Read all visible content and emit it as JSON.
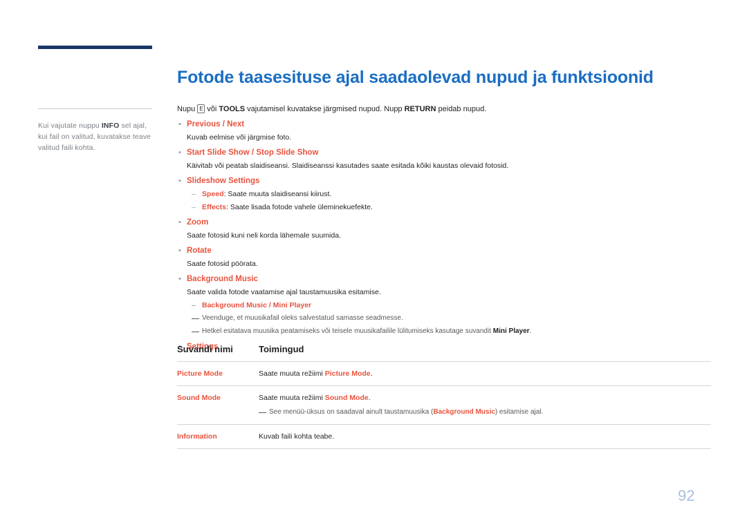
{
  "left": {
    "note_prefix": "Kui vajutate nuppu ",
    "note_key": "INFO",
    "note_suffix": " sel ajal, kui fail on valitud, kuvatakse teave valitud faili kohta."
  },
  "title": "Fotode taasesituse ajal saadaolevad nupud ja funktsioonid",
  "intro": {
    "part1": "Nupu ",
    "enter_key": "E",
    "part2": " või ",
    "tools": "TOOLS",
    "part3": " vajutamisel kuvatakse järgmised nupud. Nupp ",
    "ret": "RETURN",
    "part4": " peidab nupud."
  },
  "items": [
    {
      "label": "Previous / Next",
      "desc": "Kuvab eelmise või järgmise foto."
    },
    {
      "label": "Start Slide Show / Stop Slide Show",
      "desc": "Käivitab või peatab slaidiseansi. Slaidiseanssi kasutades saate esitada kõiki kaustas olevaid fotosid."
    },
    {
      "label": "Slideshow Settings",
      "sub": [
        {
          "hl": "Speed",
          "text": ": Saate muuta slaidiseansi kiirust."
        },
        {
          "hl": "Effects",
          "text": ": Saate lisada fotode vahele üleminekuefekte."
        }
      ]
    },
    {
      "label": "Zoom",
      "desc": "Saate fotosid kuni neli korda lähemale suumida."
    },
    {
      "label": "Rotate",
      "desc": "Saate fotosid pöörata."
    },
    {
      "label": "Background Music",
      "desc": "Saate valida fotode vaatamise ajal taustamuusika esitamise.",
      "subhead": "Background Music / Mini Player",
      "notes": [
        {
          "text": "Veenduge, et muusikafail oleks salvestatud samasse seadmesse.",
          "bold": ""
        },
        {
          "text": "Hetkel esitatava muusika peatamiseks või teisele muusikafailile lülitumiseks kasutage suvandit ",
          "bold": "Mini Player",
          "after": "."
        }
      ]
    },
    {
      "label": "Settings"
    }
  ],
  "table": {
    "headers": [
      "Suvandi nimi",
      "Toimingud"
    ],
    "rows": [
      {
        "name": "Picture Mode",
        "before": "Saate muuta režiimi ",
        "bold": "Picture Mode",
        "after": "."
      },
      {
        "name": "Sound Mode",
        "before": "Saate muuta režiimi ",
        "bold": "Sound Mode",
        "after": ".",
        "note_before": "See menüü-üksus on saadaval ainult taustamuusika (",
        "note_bold": "Background Music",
        "note_after": ") esitamise ajal."
      },
      {
        "name": "Information",
        "before": "Kuvab faili kohta teabe.",
        "bold": "",
        "after": ""
      }
    ]
  },
  "page_number": "92"
}
